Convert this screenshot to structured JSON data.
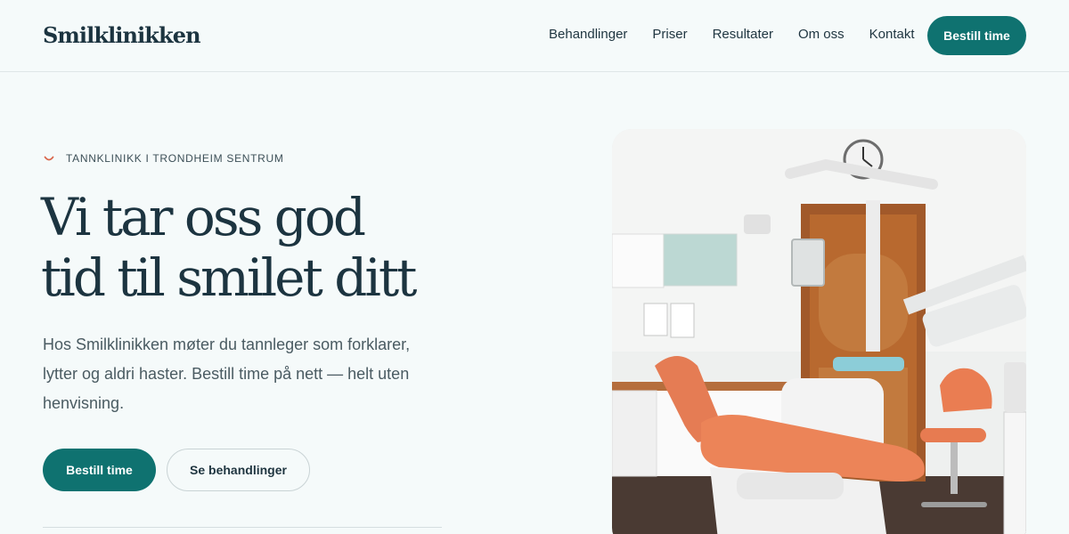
{
  "brand": {
    "name": "Smilklinikken"
  },
  "nav": {
    "items": [
      {
        "label": "Behandlinger"
      },
      {
        "label": "Priser"
      },
      {
        "label": "Resultater"
      },
      {
        "label": "Om oss"
      },
      {
        "label": "Kontakt"
      }
    ],
    "cta_label": "Bestill time"
  },
  "hero": {
    "eyebrow_icon": "smile-icon",
    "eyebrow": "TANNKLINIKK I TRONDHEIM SENTRUM",
    "headline_line1": "Vi tar oss god",
    "headline_line2": "tid til smilet ditt",
    "lede": "Hos Smilklinikken møter du tannleger som forklarer, lytter og aldri haster. Bestill time på nett — helt uten henvisning.",
    "primary_cta": "Bestill time",
    "secondary_cta": "Se behandlinger"
  },
  "colors": {
    "accent": "#0f7270",
    "heading": "#1c3440",
    "background": "#f5fafa",
    "smile": "#d9654a"
  }
}
